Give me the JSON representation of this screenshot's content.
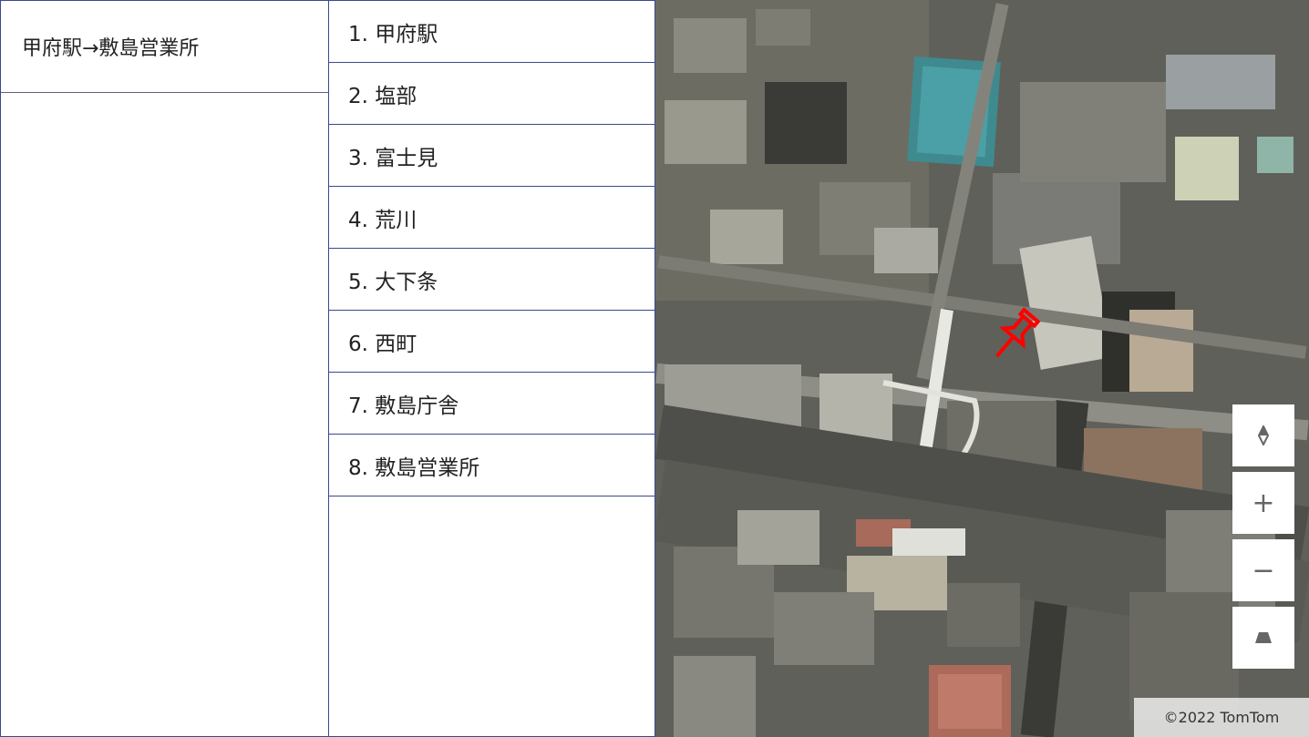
{
  "route": {
    "title": "甲府駅→敷島営業所"
  },
  "stops": [
    {
      "label": "1. 甲府駅"
    },
    {
      "label": "2. 塩部"
    },
    {
      "label": "3. 富士見"
    },
    {
      "label": "4. 荒川"
    },
    {
      "label": "5. 大下条"
    },
    {
      "label": "6. 西町"
    },
    {
      "label": "7. 敷島庁舎"
    },
    {
      "label": "8. 敷島営業所"
    }
  ],
  "map": {
    "view": "satellite",
    "marker": {
      "icon": "pushpin-icon",
      "color": "#ff0000"
    },
    "controls": [
      {
        "name": "compass-icon"
      },
      {
        "name": "zoom-in-icon",
        "glyph": "+"
      },
      {
        "name": "zoom-out-icon",
        "glyph": "−"
      },
      {
        "name": "pitch-icon"
      }
    ],
    "attribution": "©2022 TomTom"
  }
}
